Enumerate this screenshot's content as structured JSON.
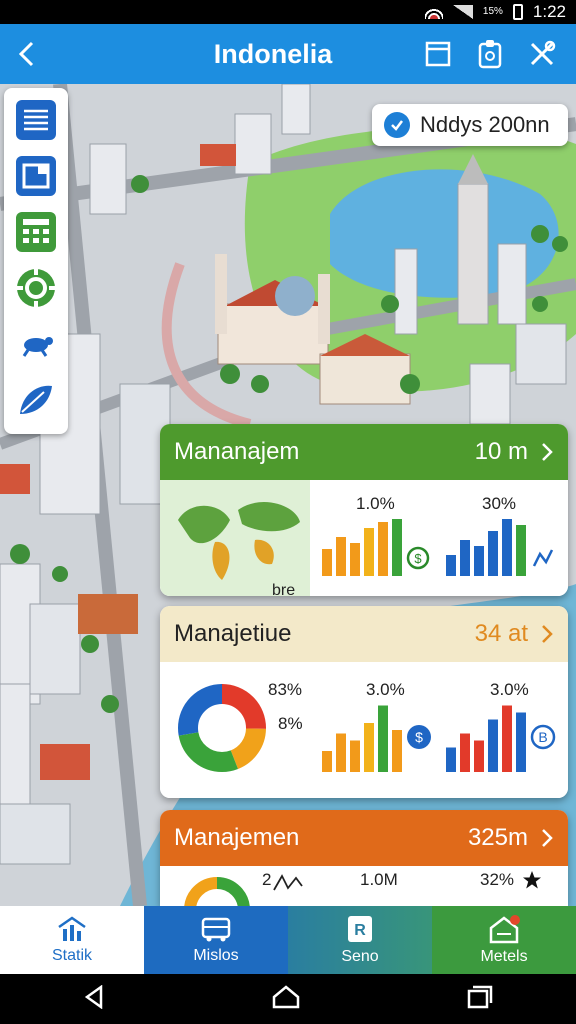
{
  "status_bar": {
    "indicator": "15%",
    "time": "1:22"
  },
  "app_bar": {
    "title": "Indonelia",
    "icons": [
      "back-arrow-icon",
      "window-icon",
      "clipboard-icon",
      "tools-icon"
    ]
  },
  "map_badge": {
    "text": "Nddys 200nn",
    "accent": "#1d7fd6"
  },
  "side_rail": {
    "icons": [
      "list-icon",
      "media-icon",
      "calculator-icon",
      "settings-gear-icon",
      "turtle-icon",
      "leaf-icon"
    ]
  },
  "cards": [
    {
      "title": "Mananajem",
      "value": "10 m",
      "header_color": "#4e9a2d",
      "chart1_pct": "1.0%",
      "chart2_pct": "30%",
      "map_label": "bre"
    },
    {
      "title": "Manajetiue",
      "value": "34 at",
      "header_color": "#f3e9c9",
      "donut_pct1": "83%",
      "donut_pct2": "8%",
      "chart1_pct": "3.0%",
      "chart2_pct": "3.0%"
    },
    {
      "title": "Manajemen",
      "value": "325m",
      "header_color": "#e06a1a",
      "label_a": "2",
      "label_b": "1.0M",
      "label_c": "32%"
    }
  ],
  "bottom_tabs": [
    {
      "label": "Statik"
    },
    {
      "label": "Mislos"
    },
    {
      "label": "Seno"
    },
    {
      "label": "Metels"
    }
  ]
}
